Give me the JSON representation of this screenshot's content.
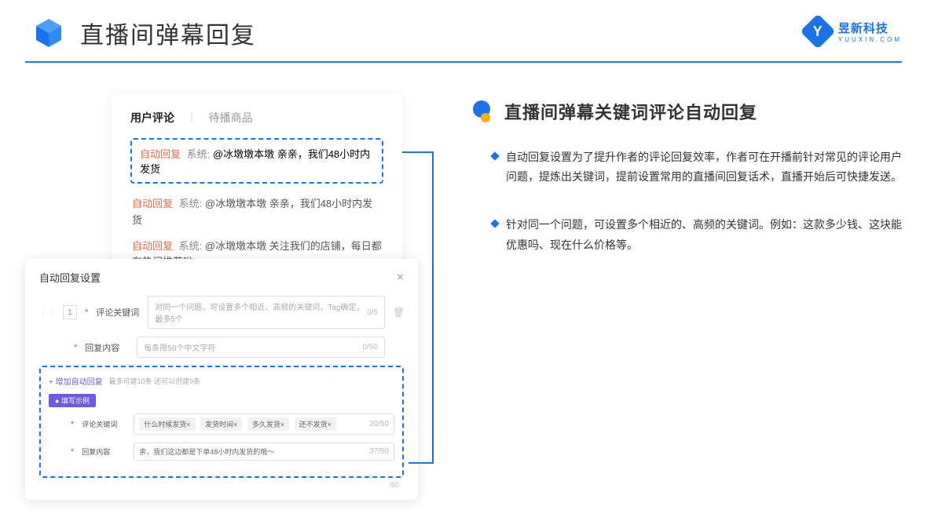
{
  "header": {
    "title": "直播间弹幕回复"
  },
  "logo": {
    "letter": "Y",
    "main": "昱新科技",
    "sub": "YUUXIN.COM"
  },
  "card1": {
    "tab_active": "用户评论",
    "tab_inactive": "待播商品",
    "tag": "自动回复",
    "sys_prefix": "系统:",
    "msg1": "@冰墩墩本墩 亲亲，我们48小时内发货",
    "msg2": "@冰墩墩本墩 亲亲，我们48小时内发货",
    "msg3": "@冰墩墩本墩 关注我们的店铺，每日都有热门推荐呦～"
  },
  "card2": {
    "title": "自动回复设置",
    "row_num": "1",
    "label_keyword": "评论关键词",
    "placeholder_keyword": "对同一个问题，可设置多个相近、高频的关键词，Tag确定，最多5个",
    "count_keyword": "0/5",
    "label_content": "回复内容",
    "placeholder_content": "每条限50个中文字符",
    "count_content": "0/50",
    "add_link": "+ 增加自动回复",
    "limit_text": "最多可建10条 还可以创建9条",
    "example_badge": "● 填写示例",
    "ex_label1": "评论关键词",
    "ex_tag1": "什么时候发货×",
    "ex_tag2": "发货时间×",
    "ex_tag3": "多久发货×",
    "ex_tag4": "还不发货×",
    "ex_count1": "20/50",
    "ex_label2": "回复内容",
    "ex_content": "亲，我们这边都是下单48小时内发货的哦～",
    "ex_count2": "37/50",
    "outer_count": "/50"
  },
  "right": {
    "title": "直播间弹幕关键词评论自动回复",
    "bullet1": "自动回复设置为了提升作者的评论回复效率，作者可在开播前针对常见的评论用户问题，提炼出关键词，提前设置常用的直播间回复话术，直播开始后可快捷发送。",
    "bullet2": "针对同一个问题，可设置多个相近的、高频的关键词。例如：这款多少钱、这块能优惠吗、现在什么价格等。"
  }
}
